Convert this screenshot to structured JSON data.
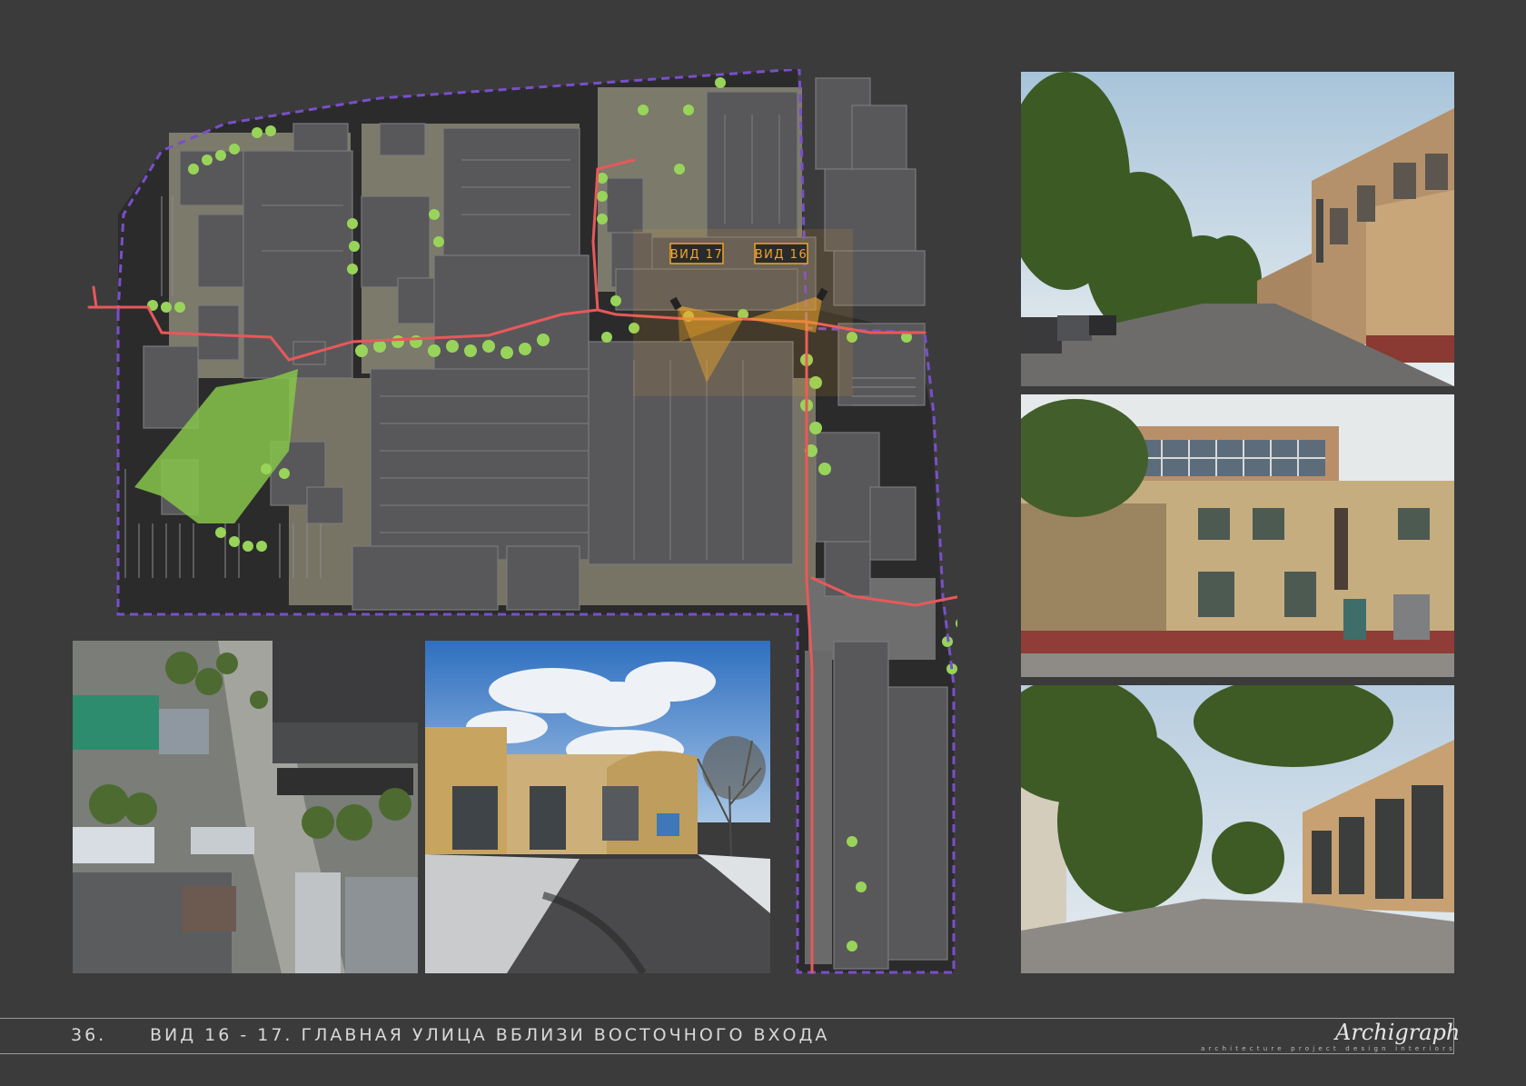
{
  "footer": {
    "page_number": "36.",
    "title": "ВИД 16 - 17. ГЛАВНАЯ УЛИЦА ВБЛИЗИ ВОСТОЧНОГО ВХОДА",
    "logo": "Archigraph",
    "logo_tagline": "architecture project design interiors"
  },
  "map": {
    "view_labels": [
      "ВИД 17",
      "ВИД 16"
    ],
    "colors": {
      "background": "#3b3b3c",
      "site": "#2a2a2b",
      "building": "#5a5a5c",
      "plaza": "#8a8776",
      "greenery": "#8fd14f",
      "route": "#e8585a",
      "boundary": "#7a4fc9",
      "highlight": "#f0a62a"
    }
  },
  "photos": [
    {
      "name": "aerial-photo",
      "icon": "aerial-view"
    },
    {
      "name": "street-snow-photo",
      "icon": "street-winter"
    },
    {
      "name": "street-perspective-photo",
      "icon": "street-summer"
    },
    {
      "name": "brick-facade-photo",
      "icon": "facade"
    },
    {
      "name": "courtyard-photo",
      "icon": "courtyard"
    }
  ]
}
